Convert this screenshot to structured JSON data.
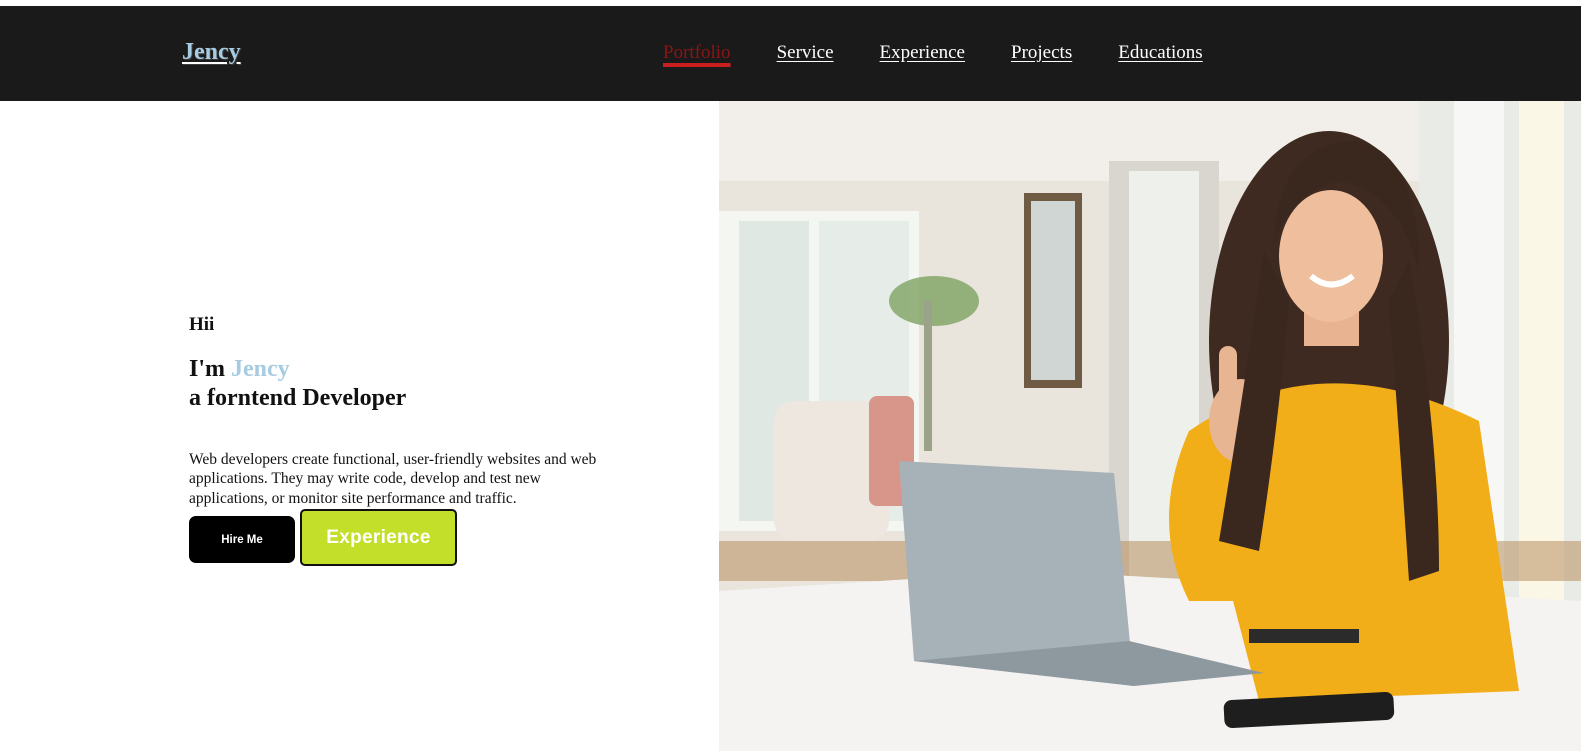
{
  "navbar": {
    "logo": "Jency",
    "links": [
      "Portfolio",
      "Service",
      "Experience",
      "Projects",
      "Educations"
    ],
    "active": "Portfolio"
  },
  "hero": {
    "greeting": "Hii",
    "intro_prefix": "I'm",
    "intro_name": "Jency",
    "role_line": "a forntend Developer",
    "description": "Web developers create functional, user-friendly websites and web applications. They may write code, develop and test new applications, or monitor site performance and traffic.",
    "buttons": {
      "hire": "Hire Me",
      "experience": "Experience"
    }
  },
  "colors": {
    "navbar_bg": "#1a1a1a",
    "accent_name": "#a7cbe0",
    "active_link": "#c91f1f",
    "experience_btn": "#c3df2a"
  }
}
